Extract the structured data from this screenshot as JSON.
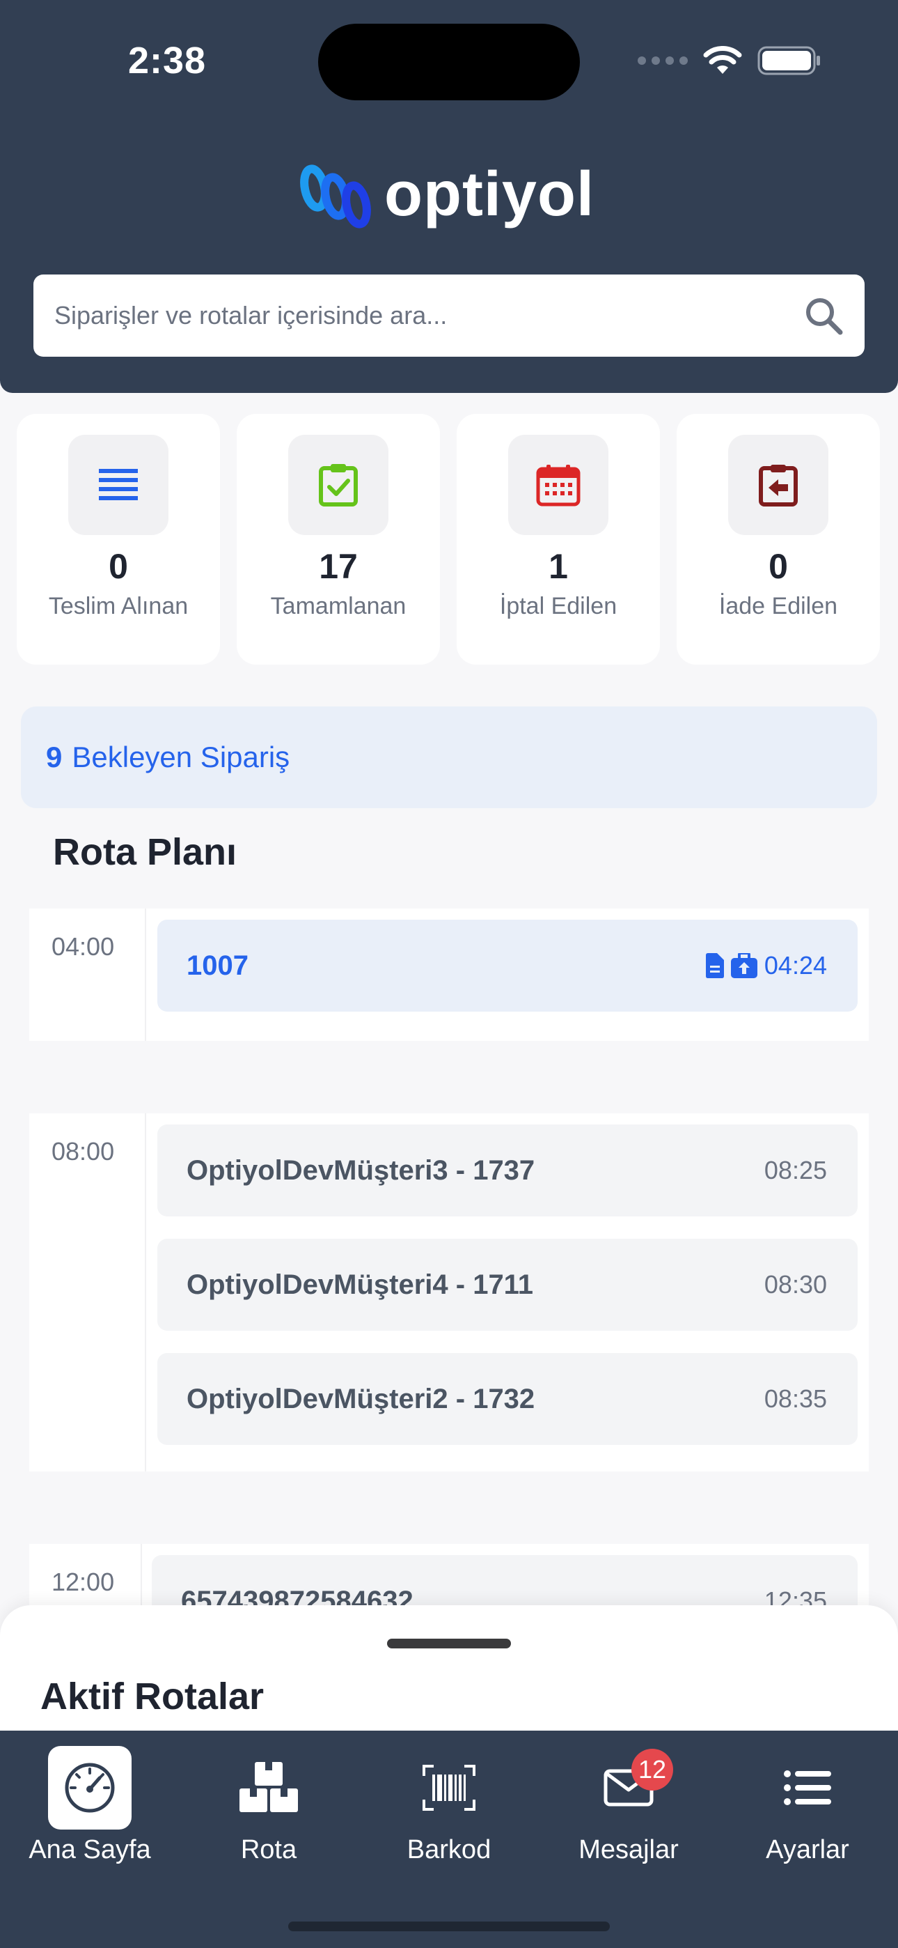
{
  "status_bar": {
    "time": "2:38"
  },
  "header": {
    "logo_text": "optiyol",
    "search": {
      "placeholder": "Siparişler ve rotalar içerisinde ara...",
      "value": ""
    }
  },
  "stats": [
    {
      "value": "0",
      "label": "Teslim Alınan",
      "icon": "list-icon",
      "color": "#2563eb"
    },
    {
      "value": "17",
      "label": "Tamamlanan",
      "icon": "clipboard-check-icon",
      "color": "#65c31a"
    },
    {
      "value": "1",
      "label": "İptal Edilen",
      "icon": "calendar-icon",
      "color": "#dc2626"
    },
    {
      "value": "0",
      "label": "İade Edilen",
      "icon": "return-icon",
      "color": "#7f1d1d"
    }
  ],
  "pending": {
    "count": "9",
    "label": "Bekleyen Sipariş"
  },
  "route_plan": {
    "title": "Rota Planı",
    "groups": [
      {
        "time": "04:00",
        "items": [
          {
            "name": "1007",
            "eta": "04:24",
            "active": true,
            "icons": [
              "document-icon",
              "briefcase-upload-icon"
            ]
          }
        ]
      },
      {
        "time": "08:00",
        "items": [
          {
            "name": "OptiyolDevMüşteri3 - 1737",
            "eta": "08:25"
          },
          {
            "name": "OptiyolDevMüşteri4 - 1711",
            "eta": "08:30"
          },
          {
            "name": "OptiyolDevMüşteri2 - 1732",
            "eta": "08:35"
          }
        ]
      },
      {
        "time": "12:00",
        "items": [
          {
            "name": "657439872584632",
            "eta": "12:35"
          }
        ]
      }
    ]
  },
  "bottom_sheet": {
    "title": "Aktif Rotalar"
  },
  "tabbar": {
    "tabs": [
      {
        "label": "Ana Sayfa",
        "icon": "speedometer-icon",
        "active": true
      },
      {
        "label": "Rota",
        "icon": "boxes-icon"
      },
      {
        "label": "Barkod",
        "icon": "barcode-scan-icon"
      },
      {
        "label": "Mesajlar",
        "icon": "mail-icon",
        "badge": "12"
      },
      {
        "label": "Ayarlar",
        "icon": "menu-list-icon"
      }
    ]
  },
  "colors": {
    "header_bg": "#323f53",
    "accent": "#2563eb",
    "badge": "#e5484d"
  }
}
